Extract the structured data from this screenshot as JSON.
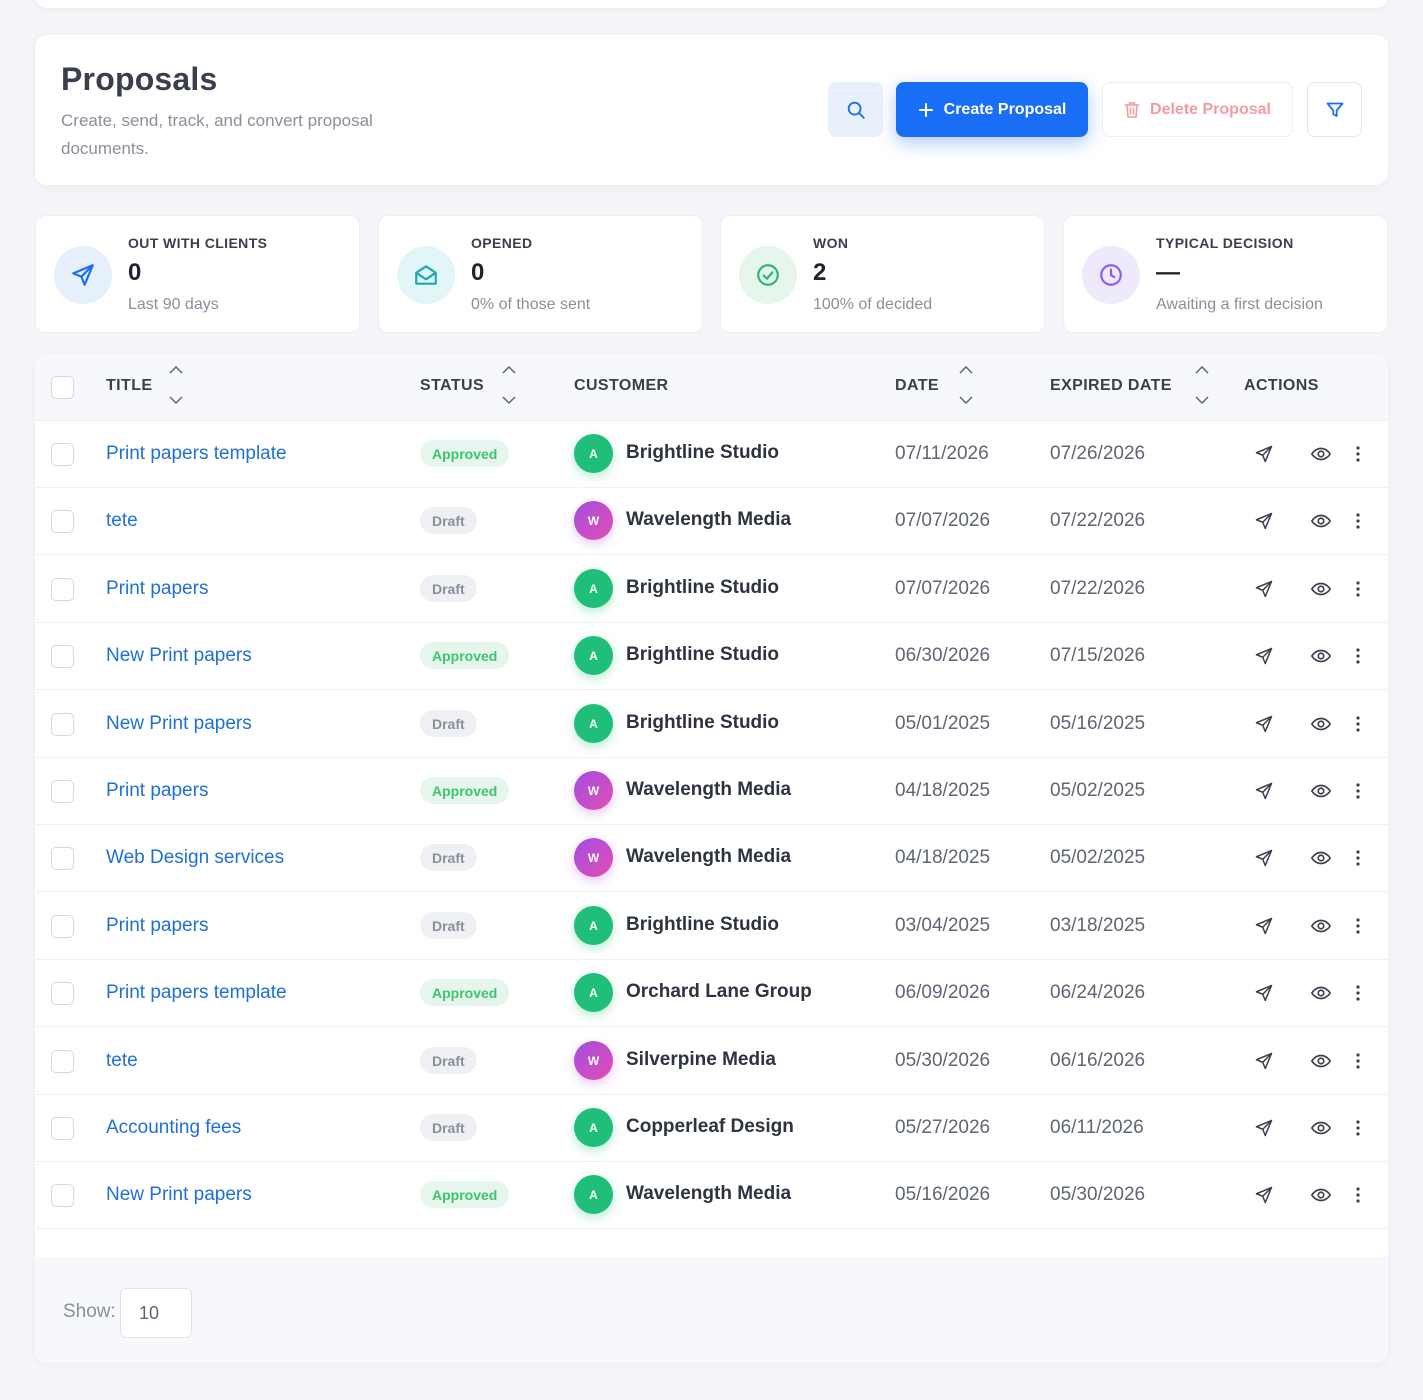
{
  "header": {
    "title": "Proposals",
    "subtitle": "Create, send, track, and convert proposal documents.",
    "create_label": "Create Proposal",
    "delete_label": "Delete Proposal"
  },
  "stats": [
    {
      "label": "OUT WITH CLIENTS",
      "value": "0",
      "sub": "Last 90 days",
      "icon": "send-icon"
    },
    {
      "label": "OPENED",
      "value": "0",
      "sub": "0% of those sent",
      "icon": "envelope-open-icon"
    },
    {
      "label": "WON",
      "value": "2",
      "sub": "100% of decided",
      "icon": "check-circle-icon"
    },
    {
      "label": "TYPICAL DECISION",
      "value": "—",
      "sub": "Awaiting a first decision",
      "icon": "clock-icon"
    }
  ],
  "table": {
    "columns": {
      "title": "TITLE",
      "status": "STATUS",
      "customer": "CUSTOMER",
      "date": "DATE",
      "expired": "EXPIRED DATE",
      "actions": "ACTIONS"
    },
    "rows": [
      {
        "title": "Print papers template",
        "status": "Approved",
        "initial": "A",
        "customer": "Brightline Studio",
        "date": "07/11/2026",
        "expired": "07/26/2026"
      },
      {
        "title": "tete",
        "status": "Draft",
        "initial": "W",
        "customer": "Wavelength Media",
        "date": "07/07/2026",
        "expired": "07/22/2026"
      },
      {
        "title": "Print papers",
        "status": "Draft",
        "initial": "A",
        "customer": "Brightline Studio",
        "date": "07/07/2026",
        "expired": "07/22/2026"
      },
      {
        "title": "New Print papers",
        "status": "Approved",
        "initial": "A",
        "customer": "Brightline Studio",
        "date": "06/30/2026",
        "expired": "07/15/2026"
      },
      {
        "title": "New Print papers",
        "status": "Draft",
        "initial": "A",
        "customer": "Brightline Studio",
        "date": "05/01/2025",
        "expired": "05/16/2025"
      },
      {
        "title": "Print papers",
        "status": "Approved",
        "initial": "W",
        "customer": "Wavelength Media",
        "date": "04/18/2025",
        "expired": "05/02/2025"
      },
      {
        "title": "Web Design services",
        "status": "Draft",
        "initial": "W",
        "customer": "Wavelength Media",
        "date": "04/18/2025",
        "expired": "05/02/2025"
      },
      {
        "title": "Print papers",
        "status": "Draft",
        "initial": "A",
        "customer": "Brightline Studio",
        "date": "03/04/2025",
        "expired": "03/18/2025"
      },
      {
        "title": "Print papers template",
        "status": "Approved",
        "initial": "A",
        "customer": "Orchard Lane Group",
        "date": "06/09/2026",
        "expired": "06/24/2026"
      },
      {
        "title": "tete",
        "status": "Draft",
        "initial": "W",
        "customer": "Silverpine Media",
        "date": "05/30/2026",
        "expired": "06/16/2026"
      },
      {
        "title": "Accounting fees",
        "status": "Draft",
        "initial": "A",
        "customer": "Copperleaf Design",
        "date": "05/27/2026",
        "expired": "06/11/2026"
      },
      {
        "title": "New Print papers",
        "status": "Approved",
        "initial": "A",
        "customer": "Wavelength Media",
        "date": "05/16/2026",
        "expired": "05/30/2026"
      }
    ]
  },
  "footer": {
    "show_label": "Show:",
    "page_size": "10"
  },
  "colors": {
    "primary": "#1a6ef5",
    "link": "#1f6fd6",
    "approved": "#3dc46f",
    "danger": "#f19ca2",
    "avatar_green": "#1fbf7a",
    "avatar_purple": "#b24edc"
  }
}
